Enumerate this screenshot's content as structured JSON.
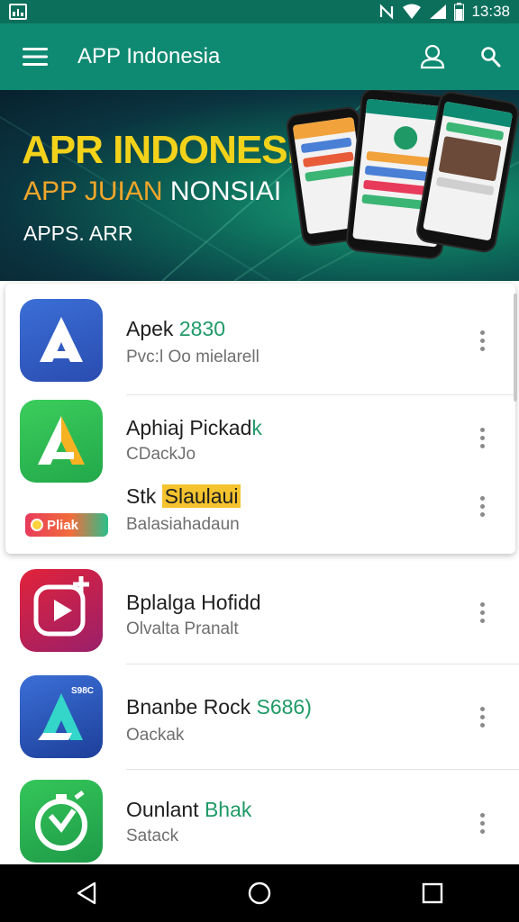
{
  "status_bar": {
    "time": "13:38",
    "icons": [
      "image-icon",
      "nfc-icon",
      "wifi-icon",
      "signal-icon",
      "battery-icon"
    ]
  },
  "app_bar": {
    "title": "APP Indonesia",
    "icons": [
      "menu-icon",
      "profile-icon",
      "search-icon"
    ],
    "color": "#0f8a72"
  },
  "banner": {
    "line1": "APR INDONESIA",
    "line2_part1": "APP JUIAN ",
    "line2_part2": "NONSIAI",
    "line3": "APPS. ARR"
  },
  "apps": [
    {
      "title": "Apek ",
      "title_accent": "2830",
      "subtitle": "Pvc:l Oo mielarell",
      "icon": "arrow-a-blue-icon"
    },
    {
      "title": "Aphiaj Pickad",
      "title_accent": "k",
      "subtitle": "CDackJo",
      "icon": "arrow-a-green-icon"
    },
    {
      "title": "Stk ",
      "title_highlight": "Slaulaui",
      "subtitle": "Balasiahadaun",
      "badge": "Pliak"
    },
    {
      "title": "Bplalga Hofidd",
      "subtitle": "Olvalta Pranalt",
      "icon": "video-play-icon"
    },
    {
      "title": "Bnanbe Rock ",
      "title_accent": "S686)",
      "subtitle": "Oackak",
      "icon": "arrow-a-cyan-icon",
      "icon_label": "S98C"
    },
    {
      "title": "Ounlant ",
      "title_accent": "Bhak",
      "subtitle": "Satack",
      "icon": "stopwatch-icon"
    }
  ],
  "nav_bar": {
    "icons": [
      "back-icon",
      "home-icon",
      "recents-icon"
    ]
  },
  "colors": {
    "status_bar": "#0c6f5c",
    "accent_green": "#1f9a67",
    "banner_yellow": "#f3d21a",
    "highlight": "#f5c32e"
  }
}
